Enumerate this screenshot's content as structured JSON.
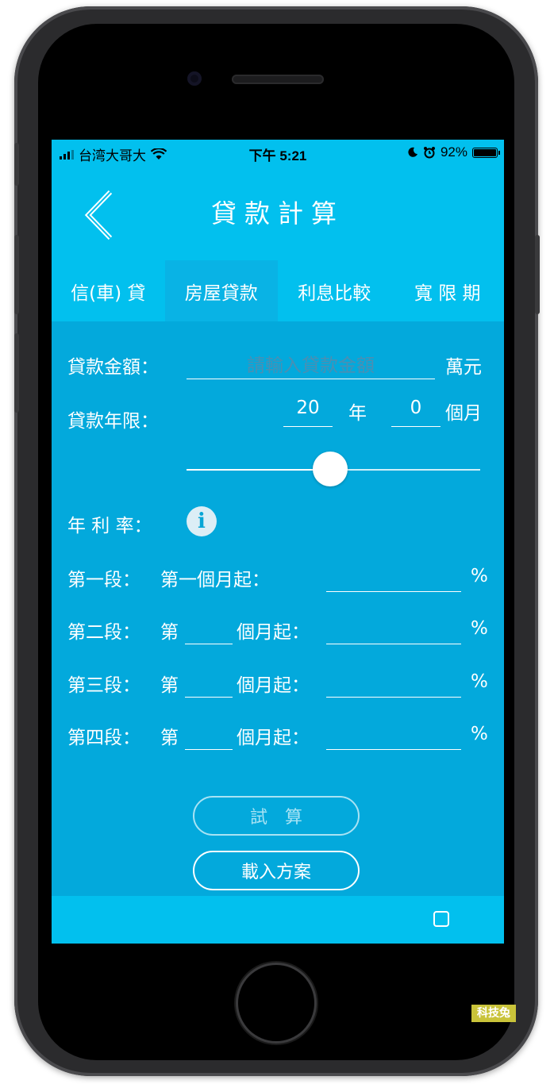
{
  "status_bar": {
    "carrier": "台湾大哥大",
    "time": "下午 5:21",
    "battery": "92%",
    "battery_level": 0.92
  },
  "header": {
    "title": "貸款計算",
    "back_icon": "chevron-left-icon"
  },
  "tabs": [
    {
      "label": "信(車) 貸",
      "active": false
    },
    {
      "label": "房屋貸款",
      "active": true
    },
    {
      "label": "利息比較",
      "active": false
    },
    {
      "label": "寬 限 期",
      "active": false
    }
  ],
  "form": {
    "amount": {
      "label": "貸款金額：",
      "placeholder": "請輸入貸款金額",
      "unit": "萬元"
    },
    "term": {
      "label": "貸款年限：",
      "years": "20",
      "year_unit": "年",
      "months": "0",
      "month_unit": "個月"
    },
    "slider_fraction": 0.5,
    "rate_label": "年 利 率：",
    "info_icon": "i",
    "segments": [
      {
        "label": "第一段：",
        "start": "第一個月起：",
        "prefix": "",
        "suffix": "",
        "unit": "%"
      },
      {
        "label": "第二段：",
        "start": "",
        "prefix": "第",
        "suffix": "個月起：",
        "unit": "%"
      },
      {
        "label": "第三段：",
        "start": "",
        "prefix": "第",
        "suffix": "個月起：",
        "unit": "%"
      },
      {
        "label": "第四段：",
        "start": "",
        "prefix": "第",
        "suffix": "個月起：",
        "unit": "%"
      }
    ]
  },
  "buttons": {
    "calculate": "試算",
    "load_plan": "載入方案"
  },
  "watermark": "科技兔",
  "colors": {
    "header_bg": "#02c0ee",
    "content_bg": "#03a9dc",
    "active_tab_bg": "#09b3e5",
    "placeholder": "#4a8fb3"
  }
}
